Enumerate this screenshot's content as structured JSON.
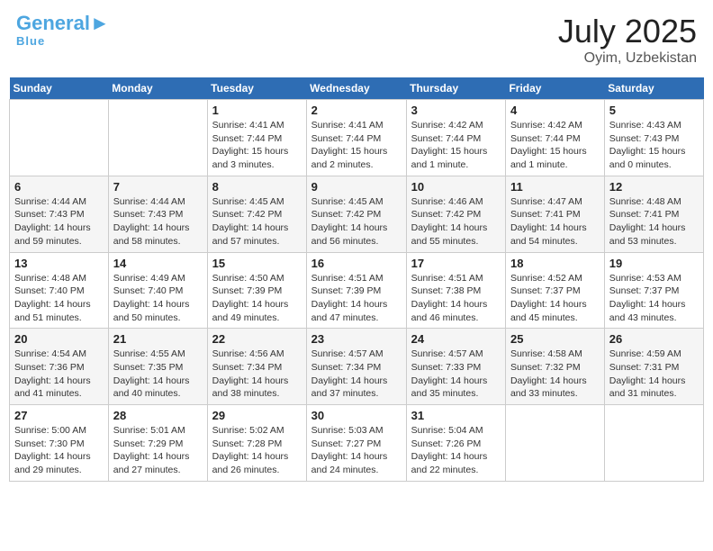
{
  "header": {
    "logo_line1": "General",
    "logo_line2": "Blue",
    "title": "July 2025",
    "location": "Oyim, Uzbekistan"
  },
  "weekdays": [
    "Sunday",
    "Monday",
    "Tuesday",
    "Wednesday",
    "Thursday",
    "Friday",
    "Saturday"
  ],
  "weeks": [
    [
      {
        "day": "",
        "info": ""
      },
      {
        "day": "",
        "info": ""
      },
      {
        "day": "1",
        "info": "Sunrise: 4:41 AM\nSunset: 7:44 PM\nDaylight: 15 hours\nand 3 minutes."
      },
      {
        "day": "2",
        "info": "Sunrise: 4:41 AM\nSunset: 7:44 PM\nDaylight: 15 hours\nand 2 minutes."
      },
      {
        "day": "3",
        "info": "Sunrise: 4:42 AM\nSunset: 7:44 PM\nDaylight: 15 hours\nand 1 minute."
      },
      {
        "day": "4",
        "info": "Sunrise: 4:42 AM\nSunset: 7:44 PM\nDaylight: 15 hours\nand 1 minute."
      },
      {
        "day": "5",
        "info": "Sunrise: 4:43 AM\nSunset: 7:43 PM\nDaylight: 15 hours\nand 0 minutes."
      }
    ],
    [
      {
        "day": "6",
        "info": "Sunrise: 4:44 AM\nSunset: 7:43 PM\nDaylight: 14 hours\nand 59 minutes."
      },
      {
        "day": "7",
        "info": "Sunrise: 4:44 AM\nSunset: 7:43 PM\nDaylight: 14 hours\nand 58 minutes."
      },
      {
        "day": "8",
        "info": "Sunrise: 4:45 AM\nSunset: 7:42 PM\nDaylight: 14 hours\nand 57 minutes."
      },
      {
        "day": "9",
        "info": "Sunrise: 4:45 AM\nSunset: 7:42 PM\nDaylight: 14 hours\nand 56 minutes."
      },
      {
        "day": "10",
        "info": "Sunrise: 4:46 AM\nSunset: 7:42 PM\nDaylight: 14 hours\nand 55 minutes."
      },
      {
        "day": "11",
        "info": "Sunrise: 4:47 AM\nSunset: 7:41 PM\nDaylight: 14 hours\nand 54 minutes."
      },
      {
        "day": "12",
        "info": "Sunrise: 4:48 AM\nSunset: 7:41 PM\nDaylight: 14 hours\nand 53 minutes."
      }
    ],
    [
      {
        "day": "13",
        "info": "Sunrise: 4:48 AM\nSunset: 7:40 PM\nDaylight: 14 hours\nand 51 minutes."
      },
      {
        "day": "14",
        "info": "Sunrise: 4:49 AM\nSunset: 7:40 PM\nDaylight: 14 hours\nand 50 minutes."
      },
      {
        "day": "15",
        "info": "Sunrise: 4:50 AM\nSunset: 7:39 PM\nDaylight: 14 hours\nand 49 minutes."
      },
      {
        "day": "16",
        "info": "Sunrise: 4:51 AM\nSunset: 7:39 PM\nDaylight: 14 hours\nand 47 minutes."
      },
      {
        "day": "17",
        "info": "Sunrise: 4:51 AM\nSunset: 7:38 PM\nDaylight: 14 hours\nand 46 minutes."
      },
      {
        "day": "18",
        "info": "Sunrise: 4:52 AM\nSunset: 7:37 PM\nDaylight: 14 hours\nand 45 minutes."
      },
      {
        "day": "19",
        "info": "Sunrise: 4:53 AM\nSunset: 7:37 PM\nDaylight: 14 hours\nand 43 minutes."
      }
    ],
    [
      {
        "day": "20",
        "info": "Sunrise: 4:54 AM\nSunset: 7:36 PM\nDaylight: 14 hours\nand 41 minutes."
      },
      {
        "day": "21",
        "info": "Sunrise: 4:55 AM\nSunset: 7:35 PM\nDaylight: 14 hours\nand 40 minutes."
      },
      {
        "day": "22",
        "info": "Sunrise: 4:56 AM\nSunset: 7:34 PM\nDaylight: 14 hours\nand 38 minutes."
      },
      {
        "day": "23",
        "info": "Sunrise: 4:57 AM\nSunset: 7:34 PM\nDaylight: 14 hours\nand 37 minutes."
      },
      {
        "day": "24",
        "info": "Sunrise: 4:57 AM\nSunset: 7:33 PM\nDaylight: 14 hours\nand 35 minutes."
      },
      {
        "day": "25",
        "info": "Sunrise: 4:58 AM\nSunset: 7:32 PM\nDaylight: 14 hours\nand 33 minutes."
      },
      {
        "day": "26",
        "info": "Sunrise: 4:59 AM\nSunset: 7:31 PM\nDaylight: 14 hours\nand 31 minutes."
      }
    ],
    [
      {
        "day": "27",
        "info": "Sunrise: 5:00 AM\nSunset: 7:30 PM\nDaylight: 14 hours\nand 29 minutes."
      },
      {
        "day": "28",
        "info": "Sunrise: 5:01 AM\nSunset: 7:29 PM\nDaylight: 14 hours\nand 27 minutes."
      },
      {
        "day": "29",
        "info": "Sunrise: 5:02 AM\nSunset: 7:28 PM\nDaylight: 14 hours\nand 26 minutes."
      },
      {
        "day": "30",
        "info": "Sunrise: 5:03 AM\nSunset: 7:27 PM\nDaylight: 14 hours\nand 24 minutes."
      },
      {
        "day": "31",
        "info": "Sunrise: 5:04 AM\nSunset: 7:26 PM\nDaylight: 14 hours\nand 22 minutes."
      },
      {
        "day": "",
        "info": ""
      },
      {
        "day": "",
        "info": ""
      }
    ]
  ]
}
